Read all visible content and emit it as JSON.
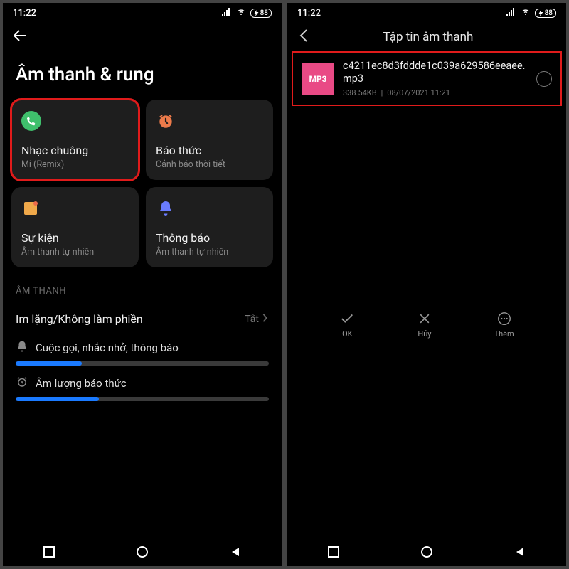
{
  "status": {
    "time": "11:22",
    "battery": "88"
  },
  "left": {
    "title": "Âm thanh & rung",
    "cards": {
      "ringtone": {
        "label": "Nhạc chuông",
        "sub": "Mi (Remix)"
      },
      "alarm": {
        "label": "Báo thức",
        "sub": "Cảnh báo thời tiết"
      },
      "events": {
        "label": "Sự kiện",
        "sub": "Âm thanh tự nhiên"
      },
      "notif": {
        "label": "Thông báo",
        "sub": "Âm thanh tự nhiên"
      }
    },
    "section": "ÂM THANH",
    "dnd": {
      "label": "Im lặng/Không làm phiền",
      "value": "Tắt"
    },
    "slider1": {
      "label": "Cuộc gọi, nhắc nhở, thông báo",
      "fill": 26
    },
    "slider2": {
      "label": "Âm lượng báo thức",
      "fill": 33
    }
  },
  "right": {
    "title": "Tập tin âm thanh",
    "file": {
      "badge": "MP3",
      "name": "c4211ec8d3fddde1c039a629586eeaee.mp3",
      "size": "338.54KB",
      "date": "08/07/2021 11:21"
    },
    "actions": {
      "ok": "OK",
      "cancel": "Hủy",
      "more": "Thêm"
    }
  }
}
